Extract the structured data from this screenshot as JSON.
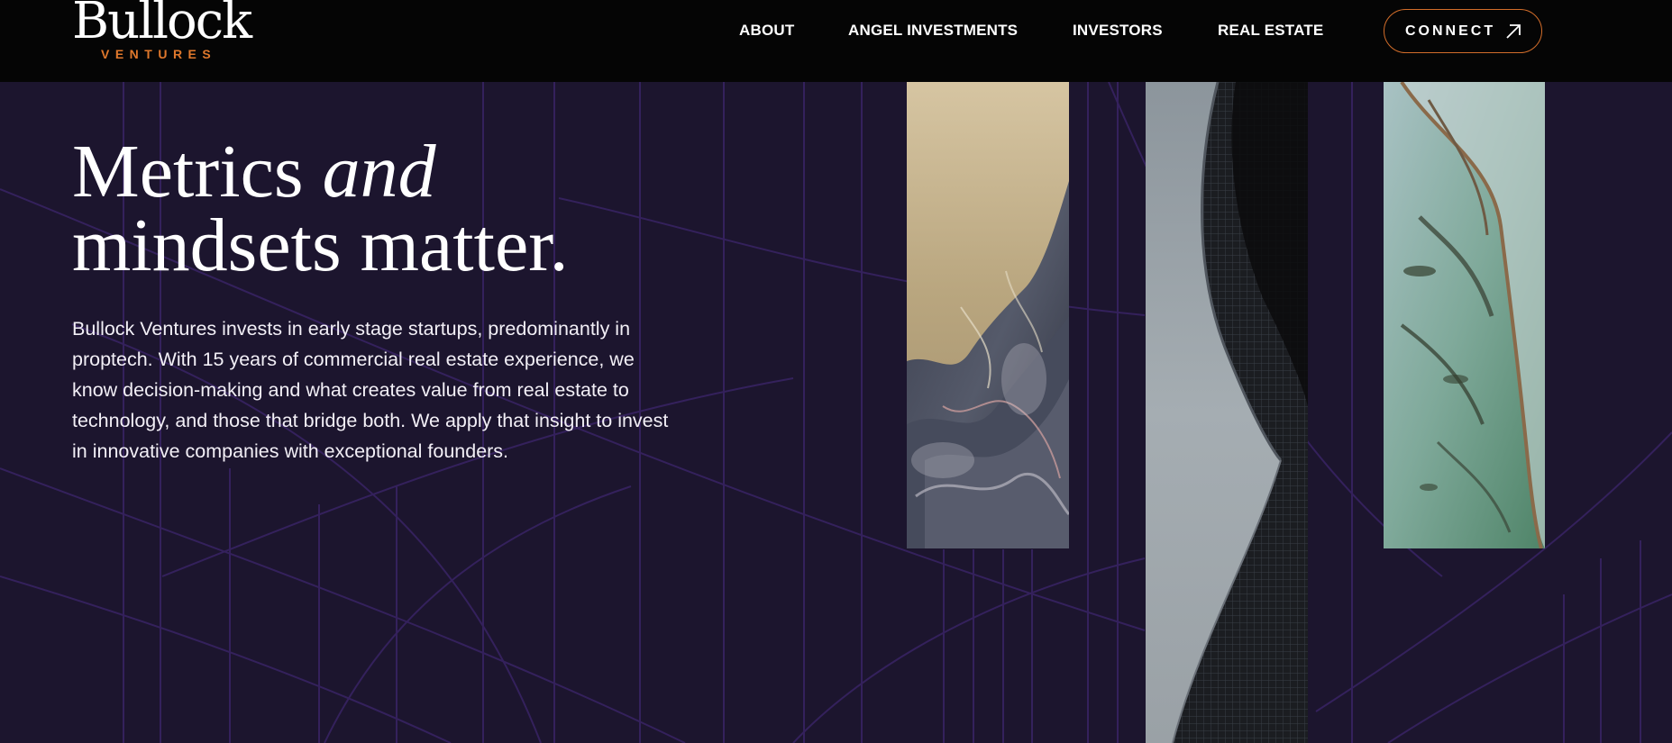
{
  "brand": {
    "name": "Bullock",
    "tagline": "VENTURES"
  },
  "nav": {
    "items": [
      "ABOUT",
      "ANGEL INVESTMENTS",
      "INVESTORS",
      "REAL ESTATE"
    ],
    "cta_label": "CONNECT",
    "cta_icon": "arrow-up-right-icon"
  },
  "hero": {
    "title_line1": "Metrics",
    "title_emphasis": "and",
    "title_line2": "mindsets matter.",
    "body": "Bullock Ventures invests in early stage startups, predominantly in proptech. With 15 years of commercial real estate experience, we know decision-making and what creates value from real estate to technology, and those that bridge both. We apply that insight to invest in innovative companies with exceptional founders."
  },
  "images": [
    {
      "name": "aerial-desert-image"
    },
    {
      "name": "curved-skyscraper-image"
    },
    {
      "name": "aerial-coastline-image"
    }
  ],
  "colors": {
    "header_bg": "#050505",
    "page_bg": "#1c152e",
    "accent": "#e0782c",
    "line": "#3a2466"
  }
}
